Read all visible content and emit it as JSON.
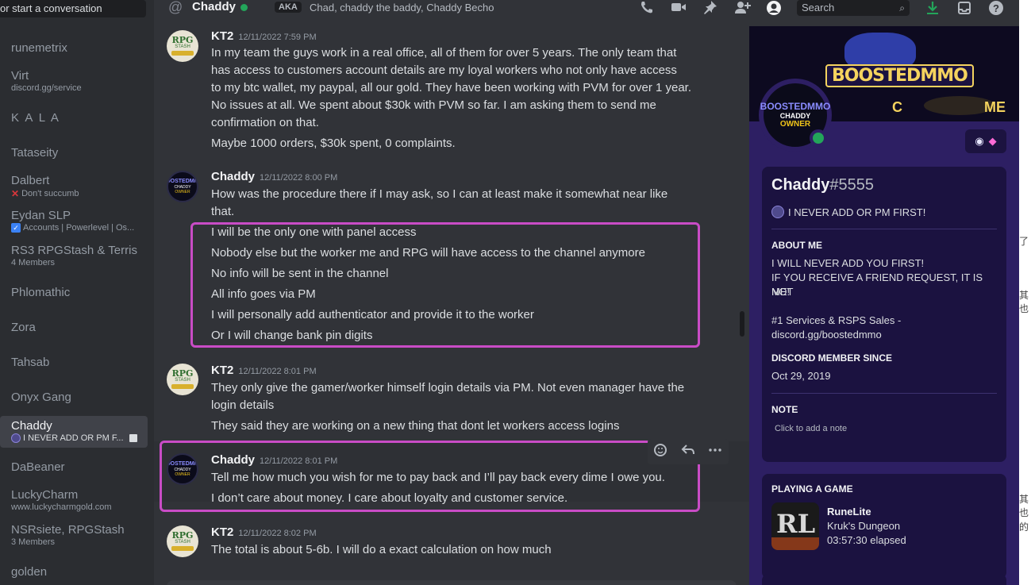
{
  "dm_list": {
    "search_placeholder": "or start a conversation",
    "items": [
      {
        "name": "runemetrix",
        "sub": ""
      },
      {
        "name": "Virt",
        "sub": "discord.gg/service"
      },
      {
        "name": "K A L A",
        "sub": ""
      },
      {
        "name": "Tataseity",
        "sub": ""
      },
      {
        "name": "Dalbert",
        "sub": "Don't succumb"
      },
      {
        "name": "Eydan SLP",
        "sub": "Accounts | Powerlevel | Os..."
      },
      {
        "name": "RS3 RPGStash & Terris",
        "sub": "4 Members"
      },
      {
        "name": "Phlomathic",
        "sub": ""
      },
      {
        "name": "Zora",
        "sub": ""
      },
      {
        "name": "Tahsab",
        "sub": ""
      },
      {
        "name": "Onyx Gang",
        "sub": ""
      },
      {
        "name": "Chaddy",
        "sub": "I NEVER ADD OR PM F..."
      },
      {
        "name": "DaBeaner",
        "sub": ""
      },
      {
        "name": "LuckyCharm",
        "sub": "www.luckycharmgold.com"
      },
      {
        "name": "NSRsiete, RPGStash",
        "sub": "3 Members"
      },
      {
        "name": "golden",
        "sub": ""
      }
    ]
  },
  "topbar": {
    "channel_name": "Chaddy",
    "aka_label": "AKA",
    "aka_names": "Chad, chaddy the baddy, Chaddy Becho",
    "search_placeholder": "Search",
    "icons": [
      "at-sign-icon",
      "phone-call-icon",
      "video-camera-icon",
      "pin-icon",
      "add-friend-icon",
      "profile-toggle-icon",
      "search-icon",
      "download-icon",
      "inbox-icon",
      "help-icon"
    ]
  },
  "messages": [
    {
      "author": "KT2",
      "time": "12/11/2022 7:59 PM",
      "lines": [
        "In my team the guys work in a real office, all of them for over 5 years. The only team that",
        "has access to customers account details are my loyal workers who not only have access",
        "to my btc wallet, my paypal, all our gold. They have been working with PVM for over 1 year.",
        "No issues at all. We spent about $30k with PVM so far. I am asking them to send me",
        "confirmation on that.",
        "Maybe 1000 orders, $30k spent, 0 complaints."
      ]
    },
    {
      "author": "Chaddy",
      "time": "12/11/2022 8:00 PM",
      "lines": [
        "How was the procedure there if I may ask, so I can at least make it somewhat near like",
        "that.",
        "I will be the only one with panel access",
        "Nobody else but the worker me and RPG will have access to the channel anymore",
        "No info will be sent in the channel",
        "All info goes via PM",
        "I will personally add authenticator and provide it to the worker",
        "Or I will change bank pin digits"
      ]
    },
    {
      "author": "KT2",
      "time": "12/11/2022 8:01 PM",
      "lines": [
        "They only give the gamer/worker himself login details via PM. Not even manager have the",
        "login details",
        "They said they are working on a new thing that dont let workers access logins"
      ]
    },
    {
      "author": "Chaddy",
      "time": "12/11/2022 8:01 PM",
      "lines": [
        "Tell me how much you wish for me to pay back and I’ll pay back every dime I owe you.",
        "I don’t care about money. I care about loyalty and customer service."
      ]
    },
    {
      "author": "KT2",
      "time": "12/11/2022 8:02 PM",
      "lines": [
        "The total is about 5-6b. I will do a exact calculation on how much"
      ]
    }
  ],
  "avatars": {
    "kt2": {
      "top": "RPG",
      "mid": "STASH"
    },
    "chaddy": {
      "l1": "BOOSTEDMMO",
      "l2": "CHADDY",
      "l3": "OWNER"
    }
  },
  "profile": {
    "banner_logo": "BOOSTEDMMO",
    "banner_c": "C",
    "banner_me": "ME",
    "username": "Chaddy",
    "discriminator": "#5555",
    "custom_status": "I NEVER ADD OR PM FIRST!",
    "about_title": "ABOUT ME",
    "about_lines": [
      "I WILL NEVER ADD YOU FIRST!",
      "IF YOU RECEIVE A FRIEND REQUEST, IT IS NOT",
      "ME!",
      "",
      "#1 Services & RSPS Sales -",
      "discord.gg/boostedmmo"
    ],
    "member_since_title": "DISCORD MEMBER SINCE",
    "member_since": "Oct 29, 2019",
    "note_title": "NOTE",
    "note_placeholder": "Click to add a note",
    "activity_title": "PLAYING A GAME",
    "game_name": "RuneLite",
    "game_icon_text": "RL",
    "game_detail": "Kruk's Dungeon",
    "game_elapsed": "03:57:30 elapsed"
  },
  "edge_fragments": [
    "了",
    "其也",
    "其也",
    "的"
  ],
  "colors": {
    "highlight": "#c94cc6",
    "online": "#23a55a",
    "profile_bg": "#2d1f63"
  }
}
